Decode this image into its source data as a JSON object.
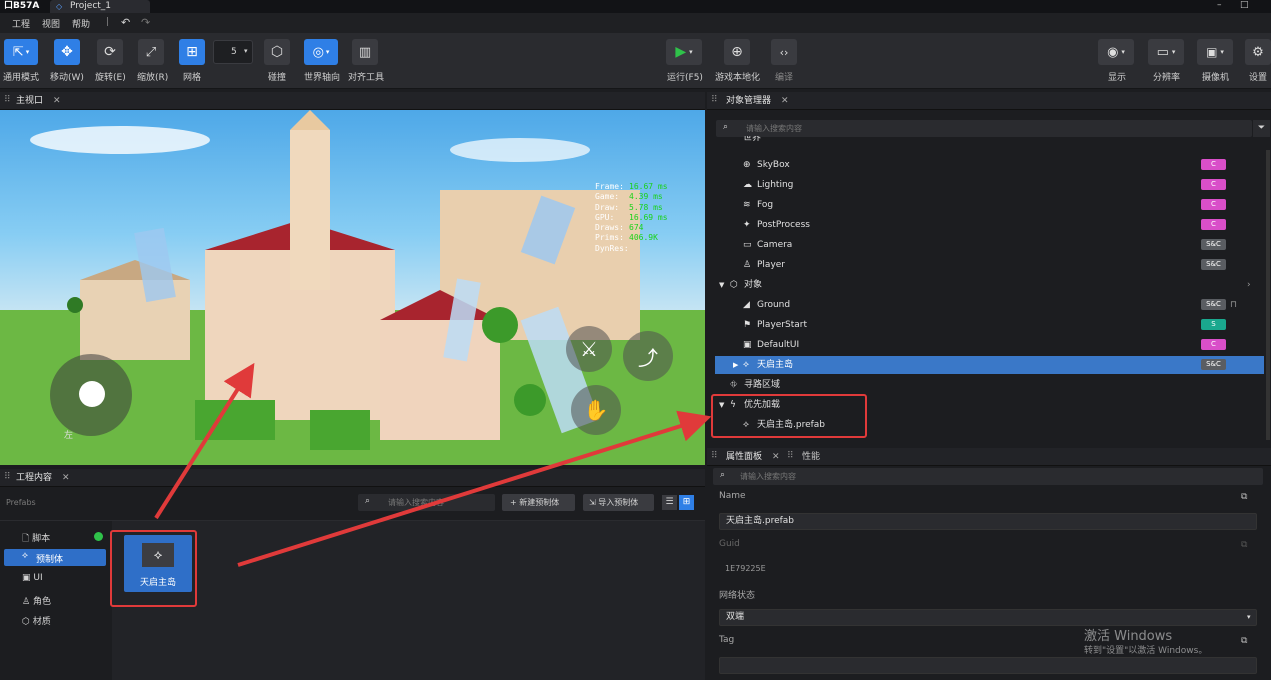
{
  "titlebar": {
    "logo": "口B57A",
    "tab": "Project_1",
    "minimize": "–",
    "maximize": "□"
  },
  "menu": {
    "items": [
      "工程",
      "视图",
      "帮助"
    ],
    "divider": "|"
  },
  "toolbar": {
    "tools": [
      {
        "label": "通用模式",
        "icon": "cursor-icon"
      },
      {
        "label": "移动(W)",
        "icon": "move-icon"
      },
      {
        "label": "旋转(E)",
        "icon": "rotate-icon"
      },
      {
        "label": "缩放(R)",
        "icon": "scale-icon"
      },
      {
        "label": "网格",
        "icon": "grid-icon"
      },
      {
        "label": "碰撞",
        "icon": "collision-icon"
      },
      {
        "label": "世界轴向",
        "icon": "world-axis-icon"
      },
      {
        "label": "对齐工具",
        "icon": "align-icon"
      }
    ],
    "grid_value": "5",
    "run": "运行(F5)",
    "localize": "游戏本地化",
    "compile": "编译",
    "display": "显示",
    "resolution": "分辨率",
    "camera": "摄像机",
    "settings": "设置"
  },
  "viewport": {
    "tab": "主视口",
    "stats": [
      {
        "k": "Frame:",
        "v": "16.67 ms"
      },
      {
        "k": "Game:",
        "v": "4.39 ms"
      },
      {
        "k": "Draw:",
        "v": "5.78 ms"
      },
      {
        "k": "GPU:",
        "v": "16.69 ms"
      },
      {
        "k": "Draws:",
        "v": "674"
      },
      {
        "k": "Prims:",
        "v": "406.9K"
      },
      {
        "k": "DynRes:",
        "v": ""
      }
    ],
    "joystick_hint": "左"
  },
  "project": {
    "tab": "工程内容",
    "breadcrumb": "Prefabs",
    "search_placeholder": "请输入搜索内容",
    "new_prefab": "新建预制体",
    "import_prefab": "导入预制体",
    "categories": [
      "脚本",
      "预制体",
      "UI",
      "角色",
      "材质"
    ],
    "asset": "天启主岛"
  },
  "objects": {
    "tab": "对象管理器",
    "search_placeholder": "请输入搜索内容",
    "partial_row": "世界",
    "rows": [
      {
        "name": "SkyBox",
        "badge": "C",
        "icon": "globe-icon"
      },
      {
        "name": "Lighting",
        "badge": "C",
        "icon": "cloud-icon"
      },
      {
        "name": "Fog",
        "badge": "C",
        "icon": "fog-icon"
      },
      {
        "name": "PostProcess",
        "badge": "C",
        "icon": "postprocess-icon"
      },
      {
        "name": "Camera",
        "badge": "S&C",
        "icon": "camera-icon"
      },
      {
        "name": "Player",
        "badge": "S&C",
        "icon": "player-icon"
      }
    ],
    "group_objects": "对象",
    "object_rows": [
      {
        "name": "Ground",
        "badge": "S&C"
      },
      {
        "name": "PlayerStart",
        "badge": "S"
      },
      {
        "name": "DefaultUI",
        "badge": "C"
      },
      {
        "name": "天启主岛",
        "badge": "S&C"
      }
    ],
    "pathfinding": "寻路区域",
    "preload": "优先加载",
    "preload_item": "天启主岛.prefab"
  },
  "properties": {
    "tab": "属性面板",
    "tab2": "性能",
    "search_placeholder": "请输入搜索内容",
    "name_label": "Name",
    "name_value": "天启主岛.prefab",
    "guid_label": "Guid",
    "guid_value": "1E79225E",
    "network_label": "网络状态",
    "network_value": "双端",
    "tag_label": "Tag"
  },
  "watermark": {
    "line1": "激活 Windows",
    "line2": "转到\"设置\"以激活 Windows。"
  },
  "colors": {
    "accent": "#2f7fe6",
    "badge_c": "#d94fc9",
    "badge_sc": "#5a5d62",
    "badge_s": "#1aa88e",
    "highlight": "#e03a3a",
    "stat_value": "#19d219"
  }
}
